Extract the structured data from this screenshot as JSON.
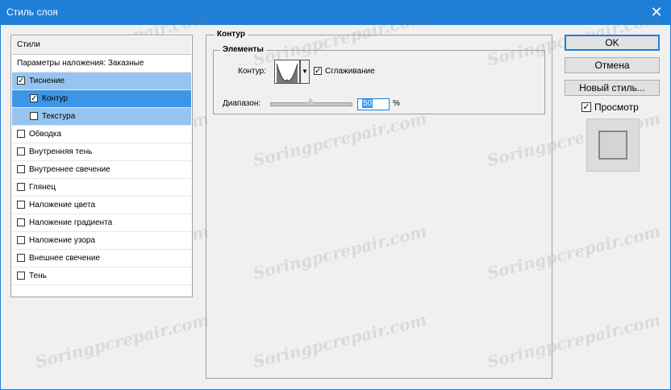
{
  "window": {
    "title": "Стиль слоя",
    "close_icon": "close-icon"
  },
  "watermark": "Soringpcrepair.com",
  "styles_panel": {
    "header": "Стили",
    "items": [
      {
        "label": "Параметры наложения: Заказные",
        "checkbox": false,
        "checked": false,
        "state": "normal",
        "indent": 0
      },
      {
        "label": "Тиснение",
        "checkbox": true,
        "checked": true,
        "state": "selected-light",
        "indent": 0
      },
      {
        "label": "Контур",
        "checkbox": true,
        "checked": true,
        "state": "selected-dark",
        "indent": 1
      },
      {
        "label": "Текстура",
        "checkbox": true,
        "checked": false,
        "state": "selected-light",
        "indent": 1
      },
      {
        "label": "Обводка",
        "checkbox": true,
        "checked": false,
        "state": "normal",
        "indent": 0
      },
      {
        "label": "Внутренняя тень",
        "checkbox": true,
        "checked": false,
        "state": "normal",
        "indent": 0
      },
      {
        "label": "Внутреннее свечение",
        "checkbox": true,
        "checked": false,
        "state": "normal",
        "indent": 0
      },
      {
        "label": "Глянец",
        "checkbox": true,
        "checked": false,
        "state": "normal",
        "indent": 0
      },
      {
        "label": "Наложение цвета",
        "checkbox": true,
        "checked": false,
        "state": "normal",
        "indent": 0
      },
      {
        "label": "Наложение градиента",
        "checkbox": true,
        "checked": false,
        "state": "normal",
        "indent": 0
      },
      {
        "label": "Наложение узора",
        "checkbox": true,
        "checked": false,
        "state": "normal",
        "indent": 0
      },
      {
        "label": "Внешнее свечение",
        "checkbox": true,
        "checked": false,
        "state": "normal",
        "indent": 0
      },
      {
        "label": "Тень",
        "checkbox": true,
        "checked": false,
        "state": "normal",
        "indent": 0
      }
    ]
  },
  "contour_section": {
    "group_title": "Контур",
    "elements_title": "Элементы",
    "contour_label": "Контур:",
    "smoothing_label": "Сглаживание",
    "smoothing_checked": true,
    "range_label": "Диапазон:",
    "range_value": "50",
    "range_unit": "%"
  },
  "buttons": {
    "ok": "OK",
    "cancel": "Отмена",
    "new_style": "Новый стиль...",
    "preview_label": "Просмотр",
    "preview_checked": true
  },
  "colors": {
    "accent": "#1e7fd8",
    "selected_light": "#96c4f0",
    "selected_dark": "#3c96e6"
  }
}
